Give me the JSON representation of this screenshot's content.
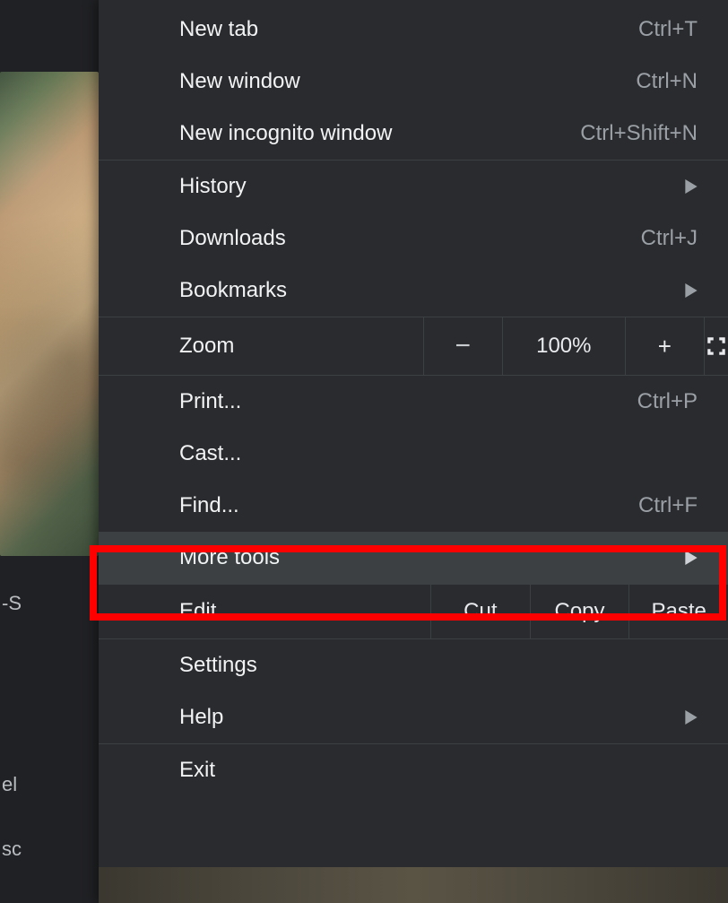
{
  "left": {
    "s": "-S",
    "el": "el",
    "sc": "sc"
  },
  "menu": {
    "new_tab": {
      "label": "New tab",
      "shortcut": "Ctrl+T"
    },
    "new_window": {
      "label": "New window",
      "shortcut": "Ctrl+N"
    },
    "incognito": {
      "label": "New incognito window",
      "shortcut": "Ctrl+Shift+N"
    },
    "history": {
      "label": "History"
    },
    "downloads": {
      "label": "Downloads",
      "shortcut": "Ctrl+J"
    },
    "bookmarks": {
      "label": "Bookmarks"
    },
    "zoom": {
      "label": "Zoom",
      "minus": "−",
      "value": "100%",
      "plus": "+"
    },
    "print": {
      "label": "Print...",
      "shortcut": "Ctrl+P"
    },
    "cast": {
      "label": "Cast..."
    },
    "find": {
      "label": "Find...",
      "shortcut": "Ctrl+F"
    },
    "more_tools": {
      "label": "More tools"
    },
    "edit": {
      "label": "Edit",
      "cut": "Cut",
      "copy": "Copy",
      "paste": "Paste"
    },
    "settings": {
      "label": "Settings"
    },
    "help": {
      "label": "Help"
    },
    "exit": {
      "label": "Exit"
    }
  }
}
